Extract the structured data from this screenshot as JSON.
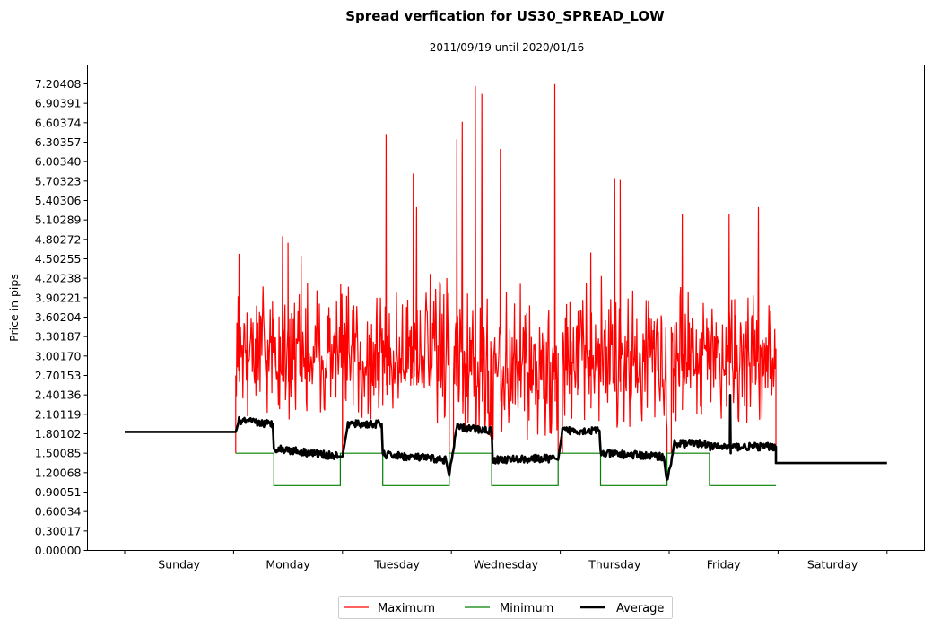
{
  "chart_data": {
    "type": "line",
    "title": "Spread verfication for US30_SPREAD_LOW",
    "subtitle": "2011/09/19 until 2020/01/16",
    "xlabel": "",
    "ylabel": "Price in pips",
    "ylim": [
      0,
      7.5
    ],
    "yticks": [
      "0.00000",
      "0.30017",
      "0.60034",
      "0.90051",
      "1.20068",
      "1.50085",
      "1.80102",
      "2.10119",
      "2.40136",
      "2.70153",
      "3.00170",
      "3.30187",
      "3.60204",
      "3.90221",
      "4.20238",
      "4.50255",
      "4.80272",
      "5.10289",
      "5.40306",
      "5.70323",
      "6.00340",
      "6.30357",
      "6.60374",
      "6.90391",
      "7.20408"
    ],
    "ytick_step": 0.30017,
    "x_categories": [
      "Sunday",
      "Monday",
      "Tuesday",
      "Wednesday",
      "Thursday",
      "Friday",
      "Saturday"
    ],
    "xlim": [
      -0.33,
      7.35
    ],
    "grid": false,
    "legend": {
      "placement": "bottom-center",
      "columns": 3
    },
    "series": [
      {
        "name": "Maximum",
        "color": "#ff0000",
        "style": "thin",
        "segments": [
          {
            "x_start": 1.02,
            "x_end": 2.0,
            "range": [
              2.0,
              4.85
            ],
            "peaks": [
              [
                1.05,
                4.58
              ],
              [
                1.45,
                4.85
              ],
              [
                1.5,
                4.75
              ],
              [
                1.62,
                4.55
              ]
            ]
          },
          {
            "x_start": 2.0,
            "x_end": 2.98,
            "range": [
              1.95,
              5.82
            ],
            "peaks": [
              [
                2.4,
                6.43
              ],
              [
                2.65,
                5.82
              ],
              [
                2.68,
                5.3
              ]
            ]
          },
          {
            "x_start": 3.02,
            "x_end": 3.98,
            "range": [
              1.7,
              7.2
            ],
            "peaks": [
              [
                3.05,
                6.35
              ],
              [
                3.1,
                6.62
              ],
              [
                3.22,
                7.17
              ],
              [
                3.28,
                7.05
              ],
              [
                3.45,
                6.2
              ],
              [
                3.95,
                7.2
              ]
            ]
          },
          {
            "x_start": 4.02,
            "x_end": 4.98,
            "range": [
              1.85,
              5.75
            ],
            "peaks": [
              [
                4.5,
                5.75
              ],
              [
                4.55,
                5.72
              ],
              [
                4.28,
                4.6
              ]
            ]
          },
          {
            "x_start": 5.02,
            "x_end": 5.98,
            "range": [
              1.95,
              5.3
            ],
            "peaks": [
              [
                5.12,
                5.2
              ],
              [
                5.55,
                5.2
              ],
              [
                5.82,
                5.3
              ]
            ]
          }
        ]
      },
      {
        "name": "Minimum",
        "color": "#008000",
        "style": "thin",
        "steps": [
          [
            1.02,
            1.5
          ],
          [
            1.37,
            1.0
          ],
          [
            1.98,
            1.5
          ],
          [
            2.37,
            1.0
          ],
          [
            2.98,
            1.5
          ],
          [
            3.37,
            1.0
          ],
          [
            3.98,
            1.5
          ],
          [
            4.37,
            1.0
          ],
          [
            4.98,
            1.5
          ],
          [
            5.37,
            1.0
          ],
          [
            5.98,
            1.0
          ]
        ]
      },
      {
        "name": "Average",
        "color": "#000000",
        "style": "thick",
        "levels": [
          [
            0.0,
            1.83
          ],
          [
            1.02,
            1.83
          ],
          [
            1.05,
            2.0
          ],
          [
            1.36,
            1.95
          ],
          [
            1.37,
            1.58
          ],
          [
            1.96,
            1.45
          ],
          [
            2.0,
            1.45
          ],
          [
            2.05,
            1.95
          ],
          [
            2.36,
            1.95
          ],
          [
            2.37,
            1.48
          ],
          [
            2.95,
            1.4
          ],
          [
            2.98,
            1.15
          ],
          [
            3.05,
            1.9
          ],
          [
            3.37,
            1.85
          ],
          [
            3.38,
            1.4
          ],
          [
            3.95,
            1.42
          ],
          [
            3.98,
            1.4
          ],
          [
            4.02,
            1.85
          ],
          [
            4.36,
            1.85
          ],
          [
            4.37,
            1.5
          ],
          [
            4.95,
            1.45
          ],
          [
            4.98,
            1.05
          ],
          [
            5.05,
            1.65
          ],
          [
            5.36,
            1.65
          ],
          [
            5.37,
            1.6
          ],
          [
            5.98,
            1.6
          ],
          [
            5.98,
            1.35
          ],
          [
            7.0,
            1.35
          ]
        ]
      }
    ]
  }
}
